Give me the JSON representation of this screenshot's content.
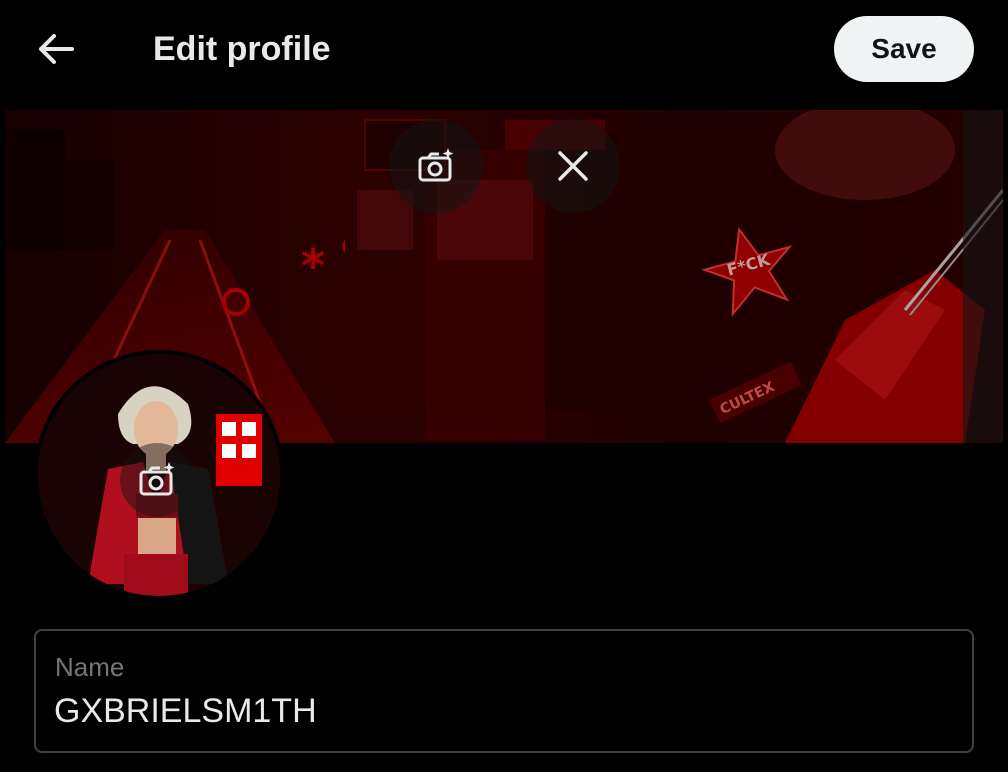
{
  "header": {
    "back_icon": "arrow-left-icon",
    "title": "Edit profile",
    "save_label": "Save"
  },
  "banner": {
    "change_photo_icon": "add-photo-camera-icon",
    "remove_icon": "close-icon",
    "sign_text": "F*CK",
    "sticker_text": "CULTEX"
  },
  "avatar": {
    "change_photo_icon": "add-photo-camera-icon"
  },
  "name_field": {
    "label": "Name",
    "value": "GXBRIELSM1TH"
  },
  "colors": {
    "background": "#000000",
    "save_button_bg": "#eff3f4",
    "save_button_text": "#0f1419",
    "field_border": "#3e4144",
    "label_gray": "#71767b",
    "banner_red": "#c40000"
  }
}
